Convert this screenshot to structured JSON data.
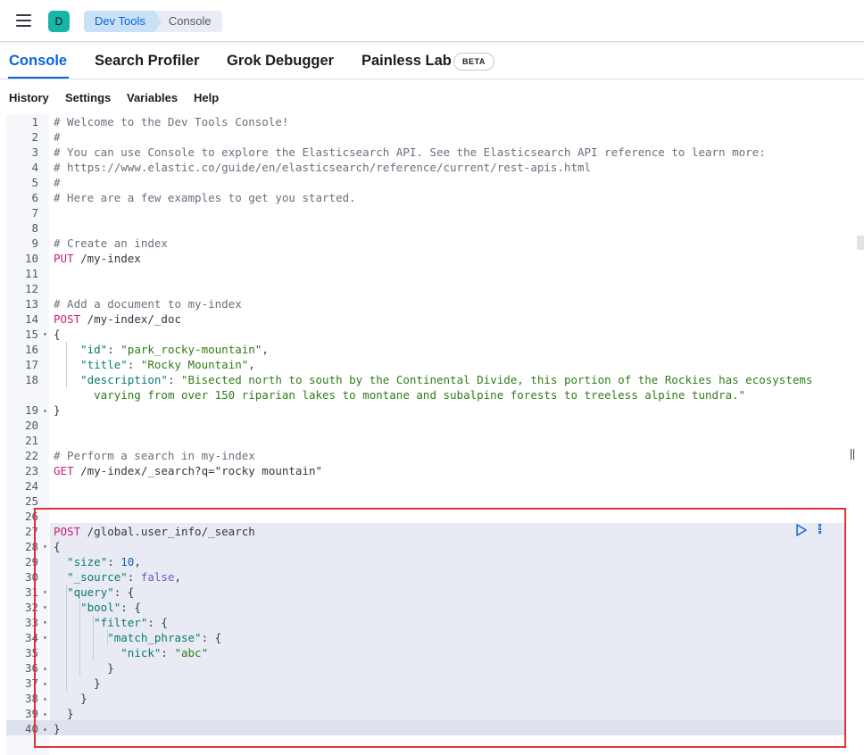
{
  "header": {
    "menu_icon": "hamburger-menu-icon",
    "avatar_initial": "D",
    "avatar_color": "#18b5a6",
    "breadcrumbs": [
      "Dev Tools",
      "Console"
    ]
  },
  "tabs": [
    {
      "label": "Console",
      "active": true
    },
    {
      "label": "Search Profiler",
      "active": false
    },
    {
      "label": "Grok Debugger",
      "active": false
    },
    {
      "label": "Painless Lab",
      "active": false,
      "badge": "BETA"
    }
  ],
  "menu": [
    "History",
    "Settings",
    "Variables",
    "Help"
  ],
  "editor": {
    "lines": [
      {
        "n": "1",
        "fold": "",
        "text": "# Welcome to the Dev Tools Console!"
      },
      {
        "n": "2",
        "fold": "",
        "text": "#"
      },
      {
        "n": "3",
        "fold": "",
        "text": "# You can use Console to explore the Elasticsearch API. See the Elasticsearch API reference to learn more:"
      },
      {
        "n": "4",
        "fold": "",
        "text": "# https://www.elastic.co/guide/en/elasticsearch/reference/current/rest-apis.html"
      },
      {
        "n": "5",
        "fold": "",
        "text": "#"
      },
      {
        "n": "6",
        "fold": "",
        "text": "# Here are a few examples to get you started."
      },
      {
        "n": "7",
        "fold": "",
        "text": ""
      },
      {
        "n": "8",
        "fold": "",
        "text": ""
      },
      {
        "n": "9",
        "fold": "",
        "text": "# Create an index"
      },
      {
        "n": "10",
        "fold": "",
        "text": "PUT /my-index"
      },
      {
        "n": "11",
        "fold": "",
        "text": ""
      },
      {
        "n": "12",
        "fold": "",
        "text": ""
      },
      {
        "n": "13",
        "fold": "",
        "text": "# Add a document to my-index"
      },
      {
        "n": "14",
        "fold": "",
        "text": "POST /my-index/_doc"
      },
      {
        "n": "15",
        "fold": "▾",
        "text": "{"
      },
      {
        "n": "16",
        "fold": "",
        "text": "    \"id\": \"park_rocky-mountain\","
      },
      {
        "n": "17",
        "fold": "",
        "text": "    \"title\": \"Rocky Mountain\","
      },
      {
        "n": "18",
        "fold": "",
        "text": "    \"description\": \"Bisected north to south by the Continental Divide, this portion of the Rockies has ecosystems\n      varying from over 150 riparian lakes to montane and subalpine forests to treeless alpine tundra.\""
      },
      {
        "n": "19",
        "fold": "▴",
        "text": "}"
      },
      {
        "n": "20",
        "fold": "",
        "text": ""
      },
      {
        "n": "21",
        "fold": "",
        "text": ""
      },
      {
        "n": "22",
        "fold": "",
        "text": "# Perform a search in my-index"
      },
      {
        "n": "23",
        "fold": "",
        "text": "GET /my-index/_search?q=\"rocky mountain\""
      },
      {
        "n": "24",
        "fold": "",
        "text": ""
      },
      {
        "n": "25",
        "fold": "",
        "text": ""
      },
      {
        "n": "26",
        "fold": "",
        "text": ""
      },
      {
        "n": "27",
        "fold": "",
        "text": "POST /global.user_info/_search"
      },
      {
        "n": "28",
        "fold": "▾",
        "text": "{"
      },
      {
        "n": "29",
        "fold": "",
        "text": "  \"size\": 10,"
      },
      {
        "n": "30",
        "fold": "",
        "text": "  \"_source\": false,"
      },
      {
        "n": "31",
        "fold": "▾",
        "text": "  \"query\": {"
      },
      {
        "n": "32",
        "fold": "▾",
        "text": "    \"bool\": {"
      },
      {
        "n": "33",
        "fold": "▾",
        "text": "      \"filter\": {"
      },
      {
        "n": "34",
        "fold": "▾",
        "text": "        \"match_phrase\": {"
      },
      {
        "n": "35",
        "fold": "",
        "text": "          \"nick\": \"abc\""
      },
      {
        "n": "36",
        "fold": "▴",
        "text": "        }"
      },
      {
        "n": "37",
        "fold": "▴",
        "text": "      }"
      },
      {
        "n": "38",
        "fold": "▴",
        "text": "    }"
      },
      {
        "n": "39",
        "fold": "▴",
        "text": "  }"
      },
      {
        "n": "40",
        "fold": "▴",
        "text": "}"
      }
    ],
    "action_icons": [
      "play-icon",
      "kebab-menu-icon"
    ]
  },
  "colors": {
    "accent": "#0b64dd",
    "method": "#c8207b",
    "json_key": "#0c7a6e",
    "json_string": "#2f7d15",
    "comment": "#69707d",
    "annotation_box": "#e0303a"
  }
}
